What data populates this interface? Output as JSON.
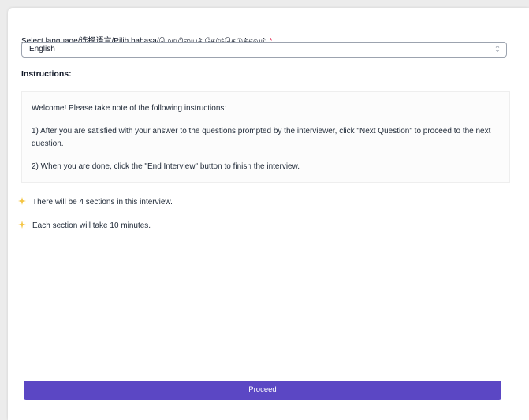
{
  "language_field": {
    "label": "Select language/选择语言/Pilih bahasa/மொழியைத் தேர்ந்தெடுக்கவும்",
    "required_marker": "*",
    "selected_value": "English"
  },
  "instructions": {
    "heading": "Instructions:",
    "welcome": "Welcome! Please take note of the following instructions:",
    "step1": "1) After you are satisfied with your answer to the questions prompted by the interviewer, click \"Next Question\" to proceed to the next question.",
    "step2": "2) When you are done, click the \"End Interview\" button to finish the interview."
  },
  "notes": [
    {
      "icon": "sparkles-icon",
      "text": "There will be 4 sections in this interview."
    },
    {
      "icon": "sparkles-icon",
      "text": "Each section will take 10 minutes."
    }
  ],
  "actions": {
    "proceed_label": "Proceed"
  },
  "colors": {
    "primary_button": "#5b47c4",
    "required": "#e11d48",
    "sparkle": "#f5c542"
  }
}
